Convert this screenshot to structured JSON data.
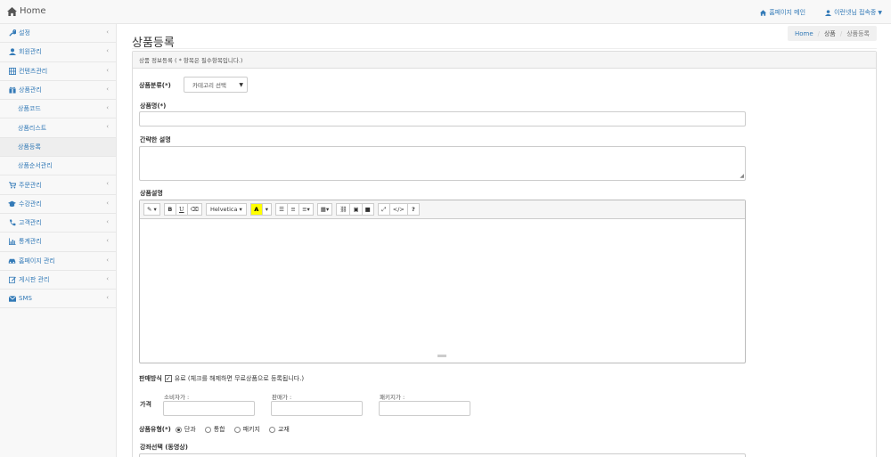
{
  "navbar": {
    "brand_icon": "home-icon",
    "brand": "Home",
    "homepage_link_icon": "home-icon",
    "homepage_link": "홈페이지 메인",
    "user_icon": "user-icon",
    "user_menu": "이런넷님 접속중"
  },
  "sidebar": {
    "items": [
      {
        "icon": "wrench-icon",
        "label": "설정"
      },
      {
        "icon": "user-icon",
        "label": "회원관리"
      },
      {
        "icon": "film-icon",
        "label": "컨텐츠관리"
      },
      {
        "icon": "gift-icon",
        "label": "상품관리"
      },
      {
        "icon": "",
        "label": "상품코드"
      },
      {
        "icon": "",
        "label": "상품리스트"
      },
      {
        "icon": "",
        "label": "상품등록"
      },
      {
        "icon": "",
        "label": "상품순서관리"
      },
      {
        "icon": "cart-icon",
        "label": "주문관리"
      },
      {
        "icon": "graduation-cap-icon",
        "label": "수강관리"
      },
      {
        "icon": "phone-icon",
        "label": "고객관리"
      },
      {
        "icon": "bar-chart-icon",
        "label": "통계관리"
      },
      {
        "icon": "car-icon",
        "label": "홈페이지 관리"
      },
      {
        "icon": "edit-icon",
        "label": "게시판 관리"
      },
      {
        "icon": "envelope-icon",
        "label": "SMS"
      }
    ],
    "active_item": "상품등록",
    "colors": {
      "link": "#337ab7",
      "active_bg": "#eeeeee"
    }
  },
  "page": {
    "title": "상품등록",
    "breadcrumb": [
      "Home",
      "상품",
      "상품등록"
    ]
  },
  "form": {
    "panel_heading": "상품 정보등록 ( * 항목은 필수항목입니다.)",
    "category_label": "상품분류(*)",
    "category_select": "카테고리 선택",
    "name_label": "상품명(*)",
    "name_value": "",
    "summary_label": "간략한 설명",
    "summary_value": "",
    "description_label": "상품설명",
    "editor_toolbar": {
      "font_name": "Helvetica",
      "bold": "B",
      "underline": "U",
      "highlight": "A",
      "help": "?",
      "code": "</>"
    },
    "sale_label": "판매방식",
    "sale_checkbox_label": "유료 (체크를 해제하면 무료상품으로 등록됩니다.)",
    "sale_checked": true,
    "price_label": "가격",
    "price_fields": [
      {
        "label": "소비자가 :",
        "value": ""
      },
      {
        "label": "판매가 :",
        "value": ""
      },
      {
        "label": "패키지가 :",
        "value": ""
      }
    ],
    "type_label": "상품유형(*)",
    "type_options": [
      "단과",
      "통합",
      "패키지",
      "교재"
    ],
    "type_selected": "단과",
    "course_label": "강좌선택 (동영상)"
  }
}
